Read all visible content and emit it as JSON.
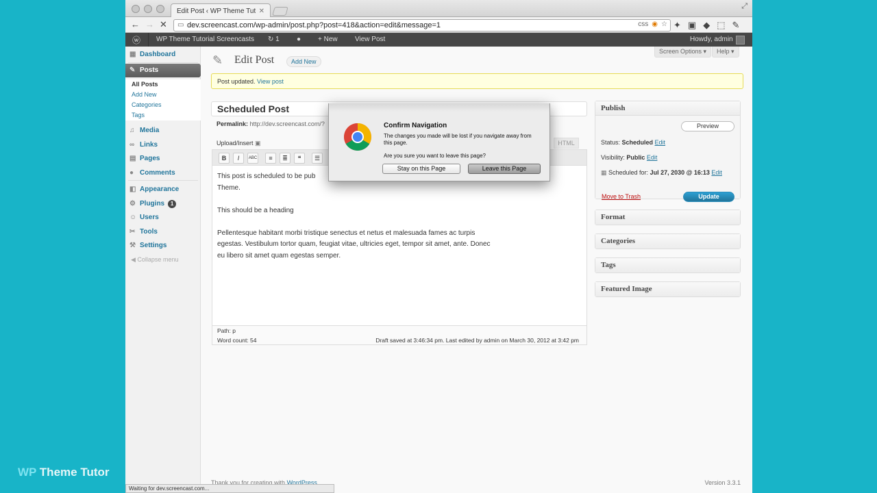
{
  "watermark": {
    "prefix": "WP",
    "rest": " Theme Tutor"
  },
  "browser": {
    "tab_title": "Edit Post ‹ WP Theme Tutoria",
    "url": "dev.screencast.com/wp-admin/post.php?post=418&action=edit&message=1",
    "status_text": "Waiting for dev.screencast.com..."
  },
  "adminbar": {
    "site": "WP Theme Tutorial Screencasts",
    "updates": "1",
    "new": "New",
    "view_post": "View Post",
    "howdy": "Howdy, admin"
  },
  "sidebar": {
    "dashboard": "Dashboard",
    "posts": "Posts",
    "posts_sub": [
      "All Posts",
      "Add New",
      "Categories",
      "Tags"
    ],
    "media": "Media",
    "links": "Links",
    "pages": "Pages",
    "comments": "Comments",
    "appearance": "Appearance",
    "plugins": "Plugins",
    "plugins_badge": "1",
    "users": "Users",
    "tools": "Tools",
    "settings": "Settings",
    "collapse": "Collapse menu"
  },
  "header": {
    "title": "Edit Post",
    "add_new": "Add New",
    "screen_options": "Screen Options ▾",
    "help": "Help ▾"
  },
  "notice": {
    "text": "Post updated. ",
    "link": "View post"
  },
  "editor": {
    "post_title": "Scheduled Post",
    "permalink_label": "Permalink:",
    "permalink_value": "http://dev.screencast.com/?",
    "upload_insert": "Upload/Insert",
    "html_tab": "HTML",
    "paragraphs": [
      "This post is scheduled to be pub",
      "Theme.",
      "This should be a heading",
      "Pellentesque habitant morbi tristique senectus et netus et malesuada fames ac turpis",
      "egestas. Vestibulum tortor quam, feugiat vitae, ultricies eget, tempor sit amet, ante. Donec",
      "eu libero sit amet quam egestas semper."
    ],
    "path": "Path: p",
    "word_count": "Word count: 54",
    "draft_saved": "Draft saved at 3:46:34 pm. Last edited by admin on March 30, 2012 at 3:42 pm"
  },
  "publish": {
    "title": "Publish",
    "preview": "Preview",
    "status_label": "Status: ",
    "status_value": "Scheduled",
    "visibility_label": "Visibility: ",
    "visibility_value": "Public",
    "scheduled_label": "Scheduled for: ",
    "scheduled_value": "Jul 27, 2030 @ 16:13",
    "edit": "Edit",
    "trash": "Move to Trash",
    "update": "Update"
  },
  "boxes": {
    "format": "Format",
    "categories": "Categories",
    "tags": "Tags",
    "featured": "Featured Image"
  },
  "footer": {
    "thanks": "Thank you for creating with ",
    "wordpress": "WordPress",
    "version": "Version 3.3.1"
  },
  "dialog": {
    "title": "Confirm Navigation",
    "message": "The changes you made will be lost if you navigate away from this page.",
    "question": "Are you sure you want to leave this page?",
    "stay": "Stay on this Page",
    "leave": "Leave this Page"
  }
}
